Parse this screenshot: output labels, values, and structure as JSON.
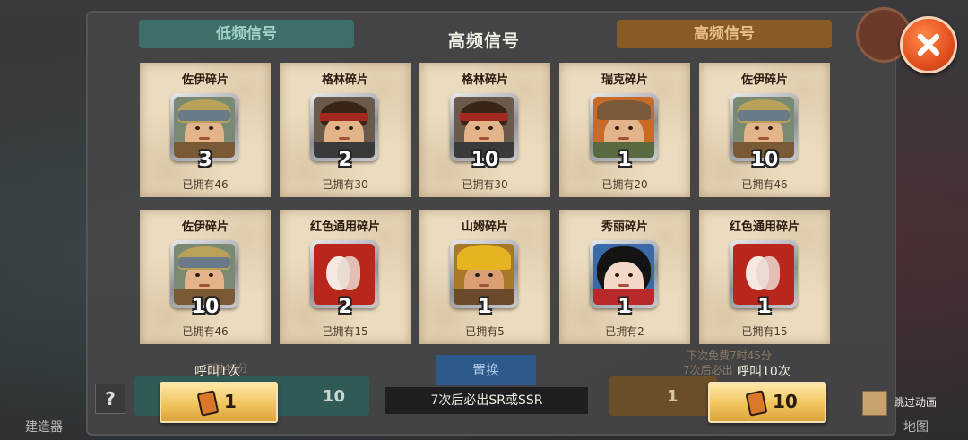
{
  "background": {
    "tab_left": "低频信号",
    "tab_right": "高频信号",
    "replace_label": "置换",
    "free_timer": "下次免费7时45分",
    "guarantee_short": "7次后必出",
    "left_timer": "7时45分",
    "left_count": "10",
    "left_label": "建造器",
    "right_label": "地图",
    "right_count_1": "1"
  },
  "dialog": {
    "title": "高频信号",
    "cards": [
      {
        "name": "佐伊碎片",
        "count": "3",
        "owned": "已拥有46",
        "portrait": "zoe"
      },
      {
        "name": "格林碎片",
        "count": "2",
        "owned": "已拥有30",
        "portrait": "green"
      },
      {
        "name": "格林碎片",
        "count": "10",
        "owned": "已拥有30",
        "portrait": "green"
      },
      {
        "name": "瑞克碎片",
        "count": "1",
        "owned": "已拥有20",
        "portrait": "rick"
      },
      {
        "name": "佐伊碎片",
        "count": "10",
        "owned": "已拥有46",
        "portrait": "zoe"
      },
      {
        "name": "佐伊碎片",
        "count": "10",
        "owned": "已拥有46",
        "portrait": "zoe"
      },
      {
        "name": "红色通用碎片",
        "count": "2",
        "owned": "已拥有15",
        "portrait": "red-generic"
      },
      {
        "name": "山姆碎片",
        "count": "1",
        "owned": "已拥有5",
        "portrait": "sam"
      },
      {
        "name": "秀丽碎片",
        "count": "1",
        "owned": "已拥有2",
        "portrait": "xiuli"
      },
      {
        "name": "红色通用碎片",
        "count": "1",
        "owned": "已拥有15",
        "portrait": "red-generic"
      }
    ],
    "call_once_label": "呼叫1次",
    "call_once_cost": "1",
    "call_ten_label": "呼叫10次",
    "call_ten_cost": "10",
    "guarantee_notice": "7次后必出SR或SSR",
    "skip_animation_label": "跳过动画"
  },
  "colors": {
    "card_bg": "#ecdcbf",
    "button_gold": "#f1c55d",
    "close_orange": "#e2501e"
  },
  "icons": [
    "close-icon",
    "phone-ticket-icon",
    "help-icon",
    "checkbox-icon"
  ]
}
